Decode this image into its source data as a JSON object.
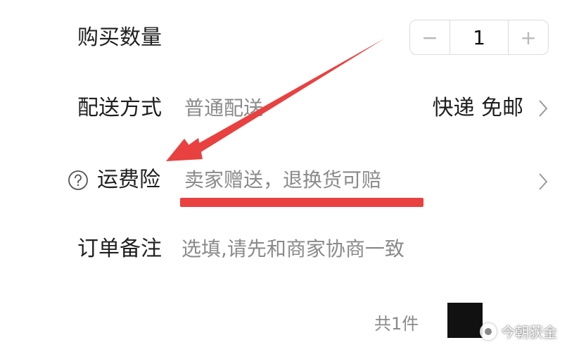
{
  "quantity_row": {
    "label": "购买数量",
    "minus": "−",
    "value": "1",
    "plus": "+"
  },
  "delivery_row": {
    "label": "配送方式",
    "value": "普通配送",
    "right": "快递 免邮"
  },
  "insurance_row": {
    "label": "运费险",
    "value": "卖家赠送，退换货可赔",
    "help_icon": "question-circle-icon"
  },
  "remark_row": {
    "label": "订单备注",
    "placeholder": "选填,请先和商家协商一致"
  },
  "footer": {
    "count": "共1件"
  },
  "watermark": {
    "text": "今朝获金"
  },
  "colors": {
    "annotation_red": "#e8413f",
    "muted_text": "#8a8a8a",
    "primary_text": "#1f1f1f"
  }
}
